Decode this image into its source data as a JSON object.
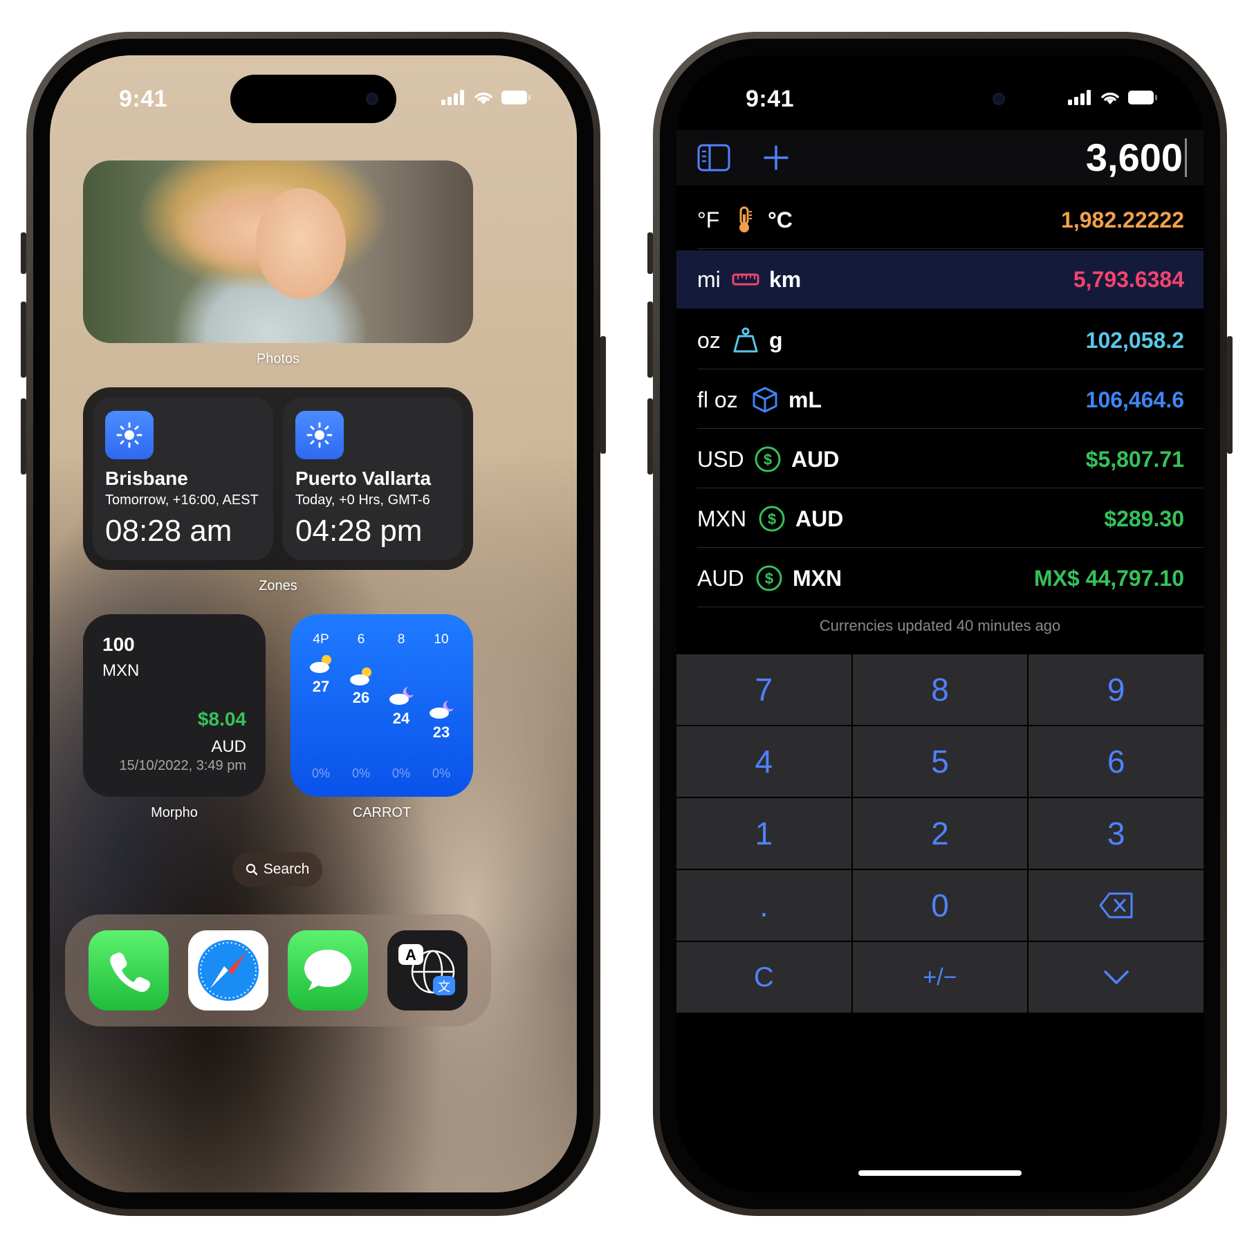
{
  "left_phone": {
    "status": {
      "time": "9:41"
    },
    "widgets": {
      "photos_label": "Photos",
      "zones": {
        "label": "Zones",
        "cards": [
          {
            "city": "Brisbane",
            "sub": "Tomorrow, +16:00, AEST",
            "time": "08:28 am",
            "icon": "sun-icon"
          },
          {
            "city": "Puerto Vallarta",
            "sub": "Today, +0 Hrs, GMT-6",
            "time": "04:28 pm",
            "icon": "sun-icon"
          }
        ]
      },
      "morpho": {
        "label": "Morpho",
        "amount": "100",
        "from_currency": "MXN",
        "result": "$8.04",
        "to_currency": "AUD",
        "date": "15/10/2022, 3:49 pm"
      },
      "carrot": {
        "label": "CARROT",
        "hours": [
          "4P",
          "6",
          "8",
          "10"
        ],
        "temps": [
          "27",
          "26",
          "24",
          "23"
        ],
        "precip": [
          "0%",
          "0%",
          "0%",
          "0%"
        ],
        "icons": [
          "cloud-sun-icon",
          "cloud-sun-icon",
          "cloud-moon-icon",
          "cloud-moon-icon"
        ]
      }
    },
    "search_label": "Search",
    "dock": [
      "phone-app-icon",
      "safari-app-icon",
      "messages-app-icon",
      "translate-app-icon"
    ]
  },
  "right_phone": {
    "status": {
      "time": "9:41"
    },
    "input": "3,600",
    "conversions": [
      {
        "from": "°F",
        "to": "°C",
        "value": "1,982.22222",
        "color": "#f2a14a",
        "icon": "thermometer-icon"
      },
      {
        "from": "mi",
        "to": "km",
        "value": "5,793.6384",
        "color": "#f2446e",
        "icon": "ruler-icon",
        "selected": true
      },
      {
        "from": "oz",
        "to": "g",
        "value": "102,058.2",
        "color": "#5ac8e8",
        "icon": "weight-icon"
      },
      {
        "from": "fl oz",
        "to": "mL",
        "value": "106,464.6",
        "color": "#3d86f5",
        "icon": "cube-icon"
      },
      {
        "from": "USD",
        "to": "AUD",
        "value": "$5,807.71",
        "color": "#35c25a",
        "icon": "dollar-icon"
      },
      {
        "from": "MXN",
        "to": "AUD",
        "value": "$289.30",
        "color": "#35c25a",
        "icon": "dollar-icon"
      },
      {
        "from": "AUD",
        "to": "MXN",
        "value": "MX$ 44,797.10",
        "color": "#35c25a",
        "icon": "dollar-icon"
      }
    ],
    "footnote": "Currencies updated 40 minutes ago",
    "keys": [
      "7",
      "8",
      "9",
      "4",
      "5",
      "6",
      "1",
      "2",
      "3",
      ".",
      "0",
      "⌫",
      "C",
      "+/−",
      "⌄"
    ]
  }
}
